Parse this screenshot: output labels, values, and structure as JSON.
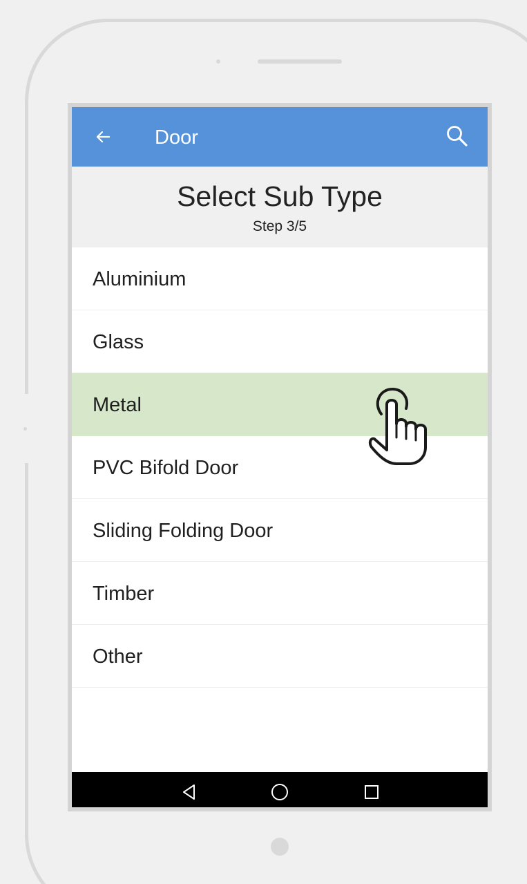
{
  "app_bar": {
    "title": "Door",
    "back_icon": "arrow-left-icon",
    "search_icon": "search-icon",
    "color": "#5592d9"
  },
  "heading": {
    "title": "Select Sub Type",
    "step": "Step 3/5"
  },
  "sub_types": [
    {
      "label": "Aluminium",
      "selected": false
    },
    {
      "label": "Glass",
      "selected": false
    },
    {
      "label": "Metal",
      "selected": true
    },
    {
      "label": "PVC Bifold Door",
      "selected": false
    },
    {
      "label": "Sliding Folding Door",
      "selected": false
    },
    {
      "label": "Timber",
      "selected": false
    },
    {
      "label": "Other",
      "selected": false
    }
  ],
  "selected_color": "#d6e8c9",
  "nav_bar": {
    "back_icon": "triangle-back-icon",
    "home_icon": "circle-home-icon",
    "recents_icon": "square-recents-icon"
  },
  "overlay": {
    "pointer_icon": "hand-pointer-icon"
  }
}
